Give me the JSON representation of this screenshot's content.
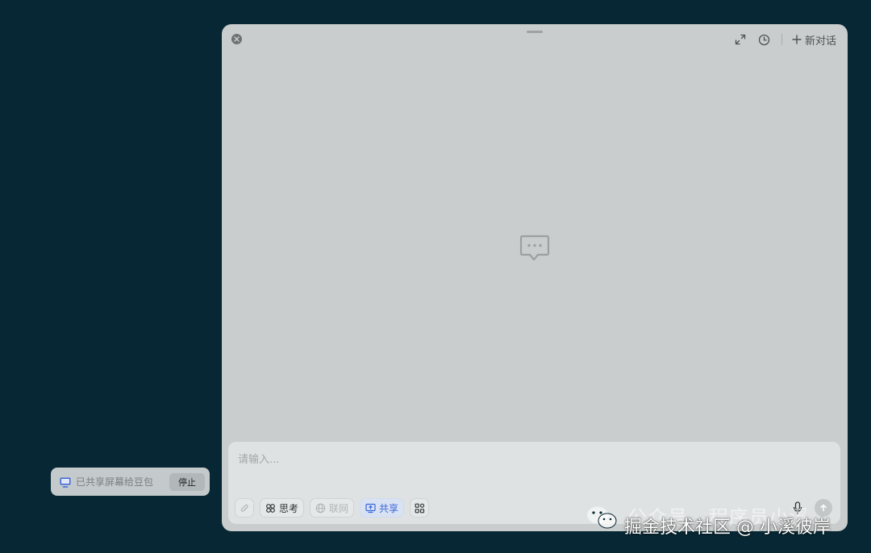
{
  "window": {
    "new_chat_label": "新对话",
    "icons": {
      "close": "close-icon",
      "expand": "expand-icon",
      "history": "clock-icon",
      "new_chat": "plus-icon",
      "empty_state": "chat-bubble-icon"
    }
  },
  "input": {
    "placeholder": "请输入..."
  },
  "toolbar": {
    "think_label": "思考",
    "web_label": "联网",
    "share_label": "共享",
    "accent_color": "#3b67d9"
  },
  "share_indicator": {
    "text": "已共享屏幕给豆包",
    "stop_label": "停止"
  },
  "watermark": {
    "line1": "公众号 · 程序员小溪",
    "line2": "掘金技术社区 @ 小溪彼岸"
  }
}
